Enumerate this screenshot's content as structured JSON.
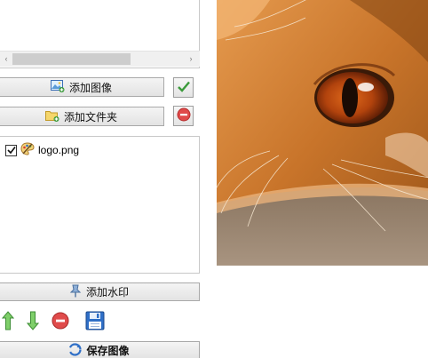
{
  "image_list": {
    "scroll_left_symbol": "‹",
    "scroll_right_symbol": "›"
  },
  "buttons": {
    "add_image": "添加图像",
    "add_folder": "添加文件夹",
    "add_watermark": "添加水印",
    "save_image": "保存图像"
  },
  "watermark_list": {
    "items": [
      {
        "name": "logo.png",
        "checked": true
      }
    ]
  },
  "icons": {
    "add_image": "image-add-icon",
    "add_folder": "folder-add-icon",
    "confirm": "checkmark-icon",
    "remove": "remove-icon",
    "add_watermark": "pin-icon",
    "move_up": "arrow-up-icon",
    "move_down": "arrow-down-icon",
    "delete": "delete-icon",
    "save": "floppy-disk-icon",
    "save_image": "refresh-icon",
    "file": "palette-icon"
  },
  "colors": {
    "accent_green": "#3a9a3a",
    "remove_red": "#e04b4b",
    "save_blue": "#2f6fc7"
  }
}
